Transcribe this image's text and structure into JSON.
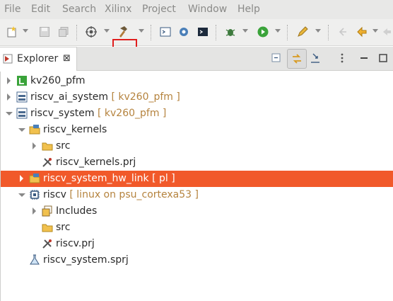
{
  "menubar": {
    "items": [
      "File",
      "Edit",
      "Search",
      "Xilinx",
      "Project",
      "Window",
      "Help"
    ]
  },
  "toolbar": {
    "icons": [
      "new-icon",
      "save-icon",
      "save-all-icon",
      "target-icon",
      "build-hammer-icon",
      "terminal-icon",
      "debug-settings-icon",
      "console-icon",
      "bug-icon",
      "run-icon",
      "pen-icon",
      "back-icon",
      "previous-icon",
      "next-icon"
    ],
    "highlight_color": "#e01e1e"
  },
  "explorer": {
    "tab_label": "Explorer",
    "close_glyph": "⊠",
    "selection_color": "#f1592a",
    "tree": [
      {
        "label": "kv260_pfm",
        "decoration": "",
        "icon": "platform-icon",
        "expanded": false,
        "depth": 0
      },
      {
        "label": "riscv_ai_system",
        "decoration": "[ kv260_pfm ]",
        "icon": "system-project-icon",
        "expanded": false,
        "depth": 0
      },
      {
        "label": "riscv_system",
        "decoration": "[ kv260_pfm ]",
        "icon": "system-project-icon",
        "expanded": true,
        "depth": 0
      },
      {
        "label": "riscv_kernels",
        "decoration": "",
        "icon": "kernel-folder-icon",
        "expanded": true,
        "depth": 1
      },
      {
        "label": "src",
        "decoration": "",
        "icon": "src-folder-icon",
        "expanded": false,
        "depth": 2
      },
      {
        "label": "riscv_kernels.prj",
        "decoration": "",
        "icon": "prj-file-icon",
        "expanded": null,
        "depth": 2
      },
      {
        "label": "riscv_system_hw_link",
        "decoration": "[ pl ]",
        "icon": "hw-link-folder-icon",
        "expanded": false,
        "depth": 1,
        "selected": true
      },
      {
        "label": "riscv",
        "decoration": "[ linux on psu_cortexa53 ]",
        "icon": "processor-icon",
        "expanded": true,
        "depth": 1
      },
      {
        "label": "Includes",
        "decoration": "",
        "icon": "includes-icon",
        "expanded": false,
        "depth": 2
      },
      {
        "label": "src",
        "decoration": "",
        "icon": "src-folder-icon",
        "expanded": null,
        "depth": 2
      },
      {
        "label": "riscv.prj",
        "decoration": "",
        "icon": "prj-file-icon",
        "expanded": null,
        "depth": 2
      },
      {
        "label": "riscv_system.sprj",
        "decoration": "",
        "icon": "sprj-file-icon",
        "expanded": null,
        "depth": 1
      }
    ]
  }
}
